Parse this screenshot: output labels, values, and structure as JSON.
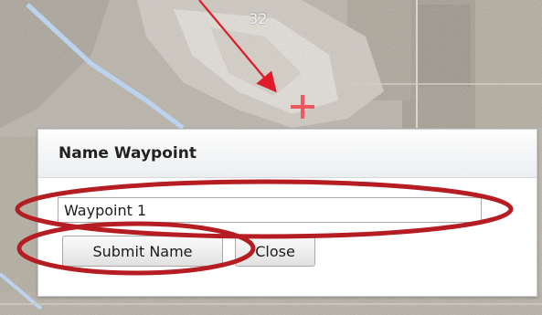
{
  "map": {
    "road_label": "32",
    "crosshair_icon": "crosshair-icon"
  },
  "dialog": {
    "title": "Name Waypoint",
    "input_value": "Waypoint 1",
    "submit_label": "Submit Name",
    "close_label": "Close"
  },
  "annotations": {
    "arrow_color": "#e01b2a",
    "ellipse_color": "#b51d22"
  }
}
